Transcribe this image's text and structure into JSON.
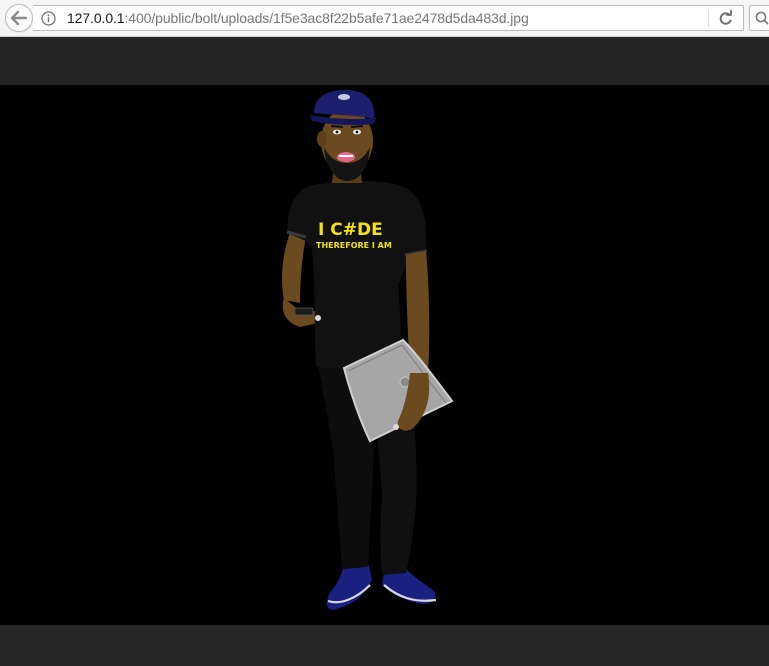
{
  "browser": {
    "url_host": "127.0.0.1",
    "url_rest": ":400/public/bolt/uploads/1f5e3ac8f22b5afe71ae2478d5da483d.jpg",
    "back_icon": "arrow-left-icon",
    "info_icon": "info-circle-icon",
    "reload_icon": "reload-icon",
    "search_icon": "search-icon"
  },
  "image": {
    "shirt_line1": "I C#DE",
    "shirt_line2": "THEREFORE I AM",
    "colors": {
      "background": "#000000",
      "viewer_bar": "#232323",
      "shirt_text": "#f4e20f",
      "cap": "#1c1f6e",
      "shoes": "#1a2080"
    }
  }
}
